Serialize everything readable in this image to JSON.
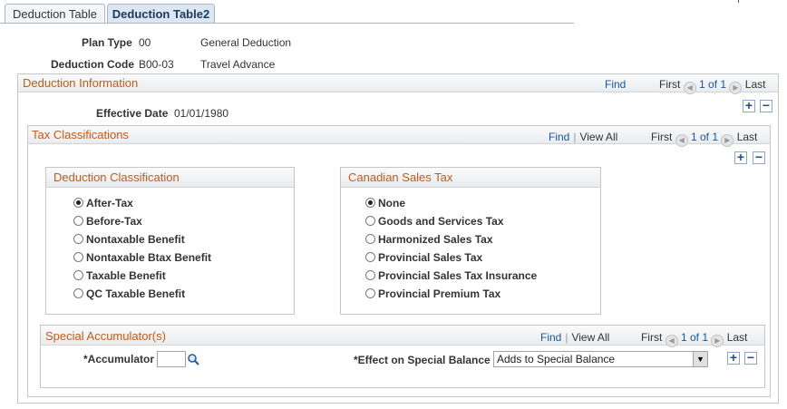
{
  "tabs": [
    {
      "label": "Deduction Table"
    },
    {
      "label": "Deduction Table2"
    }
  ],
  "header": {
    "plan_type_label": "Plan Type",
    "plan_type_code": "00",
    "plan_type_desc": "General Deduction",
    "deduction_code_label": "Deduction Code",
    "deduction_code": "B00-03",
    "deduction_desc": "Travel Advance"
  },
  "deduction_info": {
    "title": "Deduction Information",
    "find": "Find",
    "first": "First",
    "count": "1 of 1",
    "last": "Last",
    "effective_date_label": "Effective Date",
    "effective_date": "01/01/1980"
  },
  "tax_classifications": {
    "title": "Tax Classifications",
    "find": "Find",
    "view_all": "View All",
    "first": "First",
    "count": "1 of 1",
    "last": "Last"
  },
  "deduction_classification": {
    "title": "Deduction Classification",
    "options": [
      {
        "label": "After-Tax",
        "checked": true
      },
      {
        "label": "Before-Tax",
        "checked": false
      },
      {
        "label": "Nontaxable Benefit",
        "checked": false
      },
      {
        "label": "Nontaxable Btax Benefit",
        "checked": false
      },
      {
        "label": "Taxable Benefit",
        "checked": false
      },
      {
        "label": "QC Taxable Benefit",
        "checked": false
      }
    ]
  },
  "canadian_sales_tax": {
    "title": "Canadian Sales Tax",
    "options": [
      {
        "label": "None",
        "checked": true
      },
      {
        "label": "Goods and Services Tax",
        "checked": false
      },
      {
        "label": "Harmonized Sales Tax",
        "checked": false
      },
      {
        "label": "Provincial Sales Tax",
        "checked": false
      },
      {
        "label": "Provincial Sales Tax Insurance",
        "checked": false
      },
      {
        "label": "Provincial Premium Tax",
        "checked": false
      }
    ]
  },
  "special_accumulators": {
    "title": "Special Accumulator(s)",
    "find": "Find",
    "view_all": "View All",
    "first": "First",
    "count": "1 of 1",
    "last": "Last",
    "accumulator_label": "*Accumulator",
    "accumulator_value": "",
    "effect_label": "*Effect on Special Balance",
    "effect_value": "Adds to Special Balance"
  },
  "icons": {
    "prev": "arrow-left-icon",
    "next": "arrow-right-icon",
    "add": "plus-icon",
    "delete": "minus-icon",
    "lookup": "magnifier-icon",
    "dropdown": "dropdown-arrow-icon"
  },
  "colors": {
    "section_title": "#c85a14",
    "link": "#1a56a6",
    "tab_active_bg": "#dbe6f1"
  }
}
